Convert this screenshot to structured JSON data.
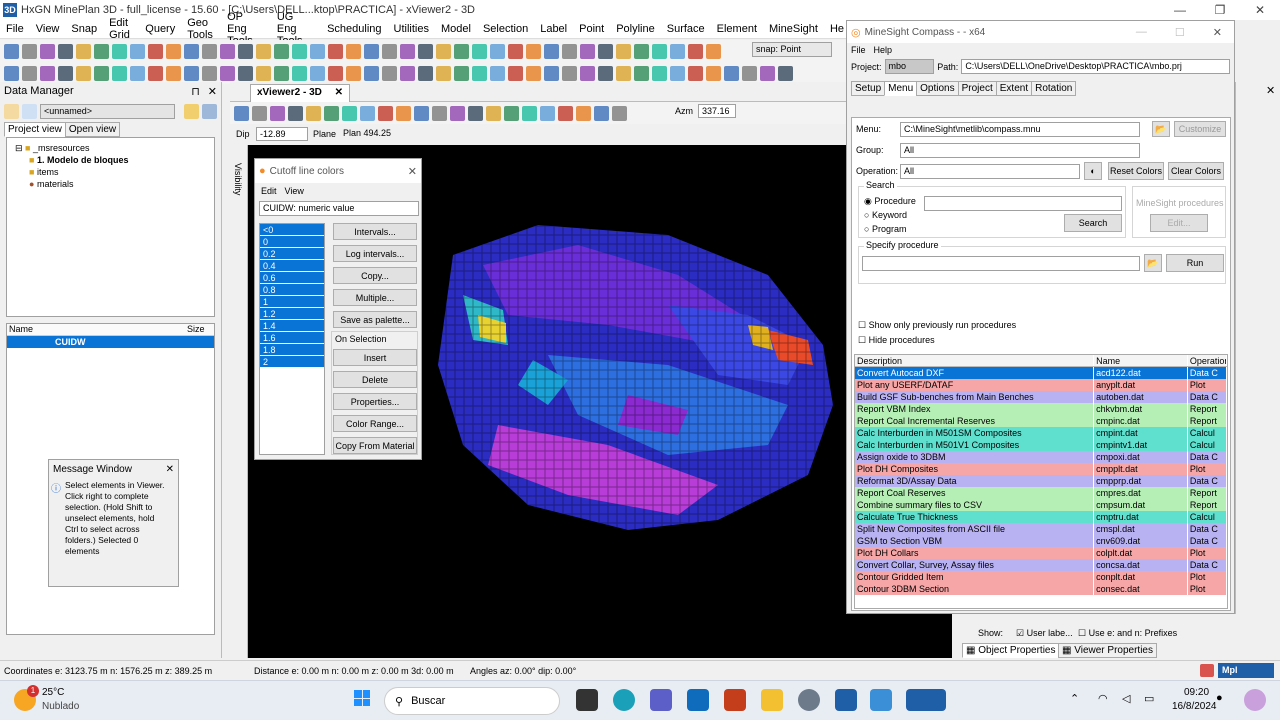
{
  "app": {
    "title": "HxGN MinePlan 3D - full_license - 15.60 - [C:\\Users\\DELL...ktop\\PRACTICA] - xViewer2 - 3D",
    "icon": "3D"
  },
  "menu": [
    "File",
    "View",
    "Snap",
    "Edit Grid",
    "Query",
    "Geo Tools",
    "OP Eng Tools",
    "UG Eng Tools",
    "Scheduling",
    "Utilities",
    "Model",
    "Selection",
    "Label",
    "Point",
    "Polyline",
    "Surface",
    "Element",
    "MineSight",
    "He"
  ],
  "toolbar": {
    "snap_label": "snap: Point"
  },
  "data_manager": {
    "title": "Data Manager",
    "unnamed": "<unnamed>",
    "tab_project": "Project view",
    "tab_open": "Open view",
    "tree": [
      "_msresources",
      "1. Modelo de bloques",
      "items",
      "materials"
    ],
    "list_header_name": "Name",
    "list_header_size": "Size",
    "list_item": "CUIDW"
  },
  "message_window": {
    "title": "Message Window",
    "text": "Select elements in Viewer. Click right to complete selection. (Hold Shift to unselect elements, hold Ctrl to select across folders.) Selected 0 elements"
  },
  "viewer": {
    "tab": "xViewer2 - 3D",
    "azm_label": "Azm",
    "azm": "337.16",
    "dip_label": "Dip",
    "dip": "-12.89",
    "plane_label": "Plane",
    "plane": "Plan 494.25",
    "visibility": "Visibility"
  },
  "cutoff": {
    "title": "Cutoff line colors",
    "menu": [
      "Edit",
      "View"
    ],
    "field": "CUIDW: numeric value",
    "values": [
      "<0",
      "0",
      "0.2",
      "0.4",
      "0.6",
      "0.8",
      "1",
      "1.2",
      "1.4",
      "1.6",
      "1.8",
      "2"
    ],
    "buttons": [
      "Intervals...",
      "Log intervals...",
      "Copy...",
      "Multiple...",
      "Save as palette..."
    ],
    "on_selection": "On Selection",
    "sel_buttons": [
      "Insert",
      "Delete",
      "Properties...",
      "Color Range...",
      "Copy From Material"
    ]
  },
  "compass": {
    "title": "MineSight Compass -  - x64",
    "menu": [
      "File",
      "Help"
    ],
    "project_label": "Project:",
    "project": "mbo",
    "path_label": "Path:",
    "path": "C:\\Users\\DELL\\OneDrive\\Desktop\\PRACTICA\\mbo.prj",
    "tabs": [
      "Setup",
      "Menu",
      "Options",
      "Project",
      "Extent",
      "Rotation"
    ],
    "menu_label": "Menu:",
    "menu_value": "C:\\MineSight\\metlib\\compass.mnu",
    "customize": "Customize",
    "group_label": "Group:",
    "group_value": "All",
    "operation_label": "Operation:",
    "operation_value": "All",
    "reset_colors": "Reset Colors",
    "clear_colors": "Clear Colors",
    "search_title": "Search",
    "radio": [
      "Procedure",
      "Keyword",
      "Program"
    ],
    "search_btn": "Search",
    "ms_proc": "MineSight procedures",
    "edit": "Edit...",
    "specify": "Specify procedure",
    "run": "Run",
    "chk1": "Show only previously run procedures",
    "chk2": "Hide procedures",
    "cols": [
      "Description",
      "Name",
      "Operation"
    ],
    "rows": [
      {
        "d": "Convert Autocad DXF",
        "n": "acd122.dat",
        "o": "Data C",
        "c": "sel"
      },
      {
        "d": "Plot any USERF/DATAF",
        "n": "anyplt.dat",
        "o": "Plot",
        "c": "c-red"
      },
      {
        "d": "Build GSF Sub-benches from Main Benches",
        "n": "autoben.dat",
        "o": "Data C",
        "c": "c-pur"
      },
      {
        "d": "Report VBM Index",
        "n": "chkvbm.dat",
        "o": "Report",
        "c": "c-green"
      },
      {
        "d": "Report Coal Incremental Reserves",
        "n": "cmpinc.dat",
        "o": "Report",
        "c": "c-green"
      },
      {
        "d": "Calc Interburden in M501SM Composites",
        "n": "cmpint.dat",
        "o": "Calcul",
        "c": "c-teal"
      },
      {
        "d": "Calc Interburden in M501V1 Composites",
        "n": "cmpintv1.dat",
        "o": "Calcul",
        "c": "c-teal"
      },
      {
        "d": "Assign oxide to 3DBM",
        "n": "cmpoxi.dat",
        "o": "Data C",
        "c": "c-pur"
      },
      {
        "d": "Plot DH Composites",
        "n": "cmpplt.dat",
        "o": "Plot",
        "c": "c-red"
      },
      {
        "d": "Reformat 3D/Assay Data",
        "n": "cmpprp.dat",
        "o": "Data C",
        "c": "c-pur"
      },
      {
        "d": "Report Coal Reserves",
        "n": "cmpres.dat",
        "o": "Report",
        "c": "c-green"
      },
      {
        "d": "Combine summary files to CSV",
        "n": "cmpsum.dat",
        "o": "Report",
        "c": "c-green"
      },
      {
        "d": "Calculate True Thickness",
        "n": "cmptru.dat",
        "o": "Calcul",
        "c": "c-teal"
      },
      {
        "d": "Split New Composites from ASCII file",
        "n": "cmspl.dat",
        "o": "Data C",
        "c": "c-pur"
      },
      {
        "d": "GSM to Section VBM",
        "n": "cnv609.dat",
        "o": "Data C",
        "c": "c-pur"
      },
      {
        "d": "Plot DH Collars",
        "n": "colplt.dat",
        "o": "Plot",
        "c": "c-red"
      },
      {
        "d": "Convert Collar, Survey, Assay files",
        "n": "concsa.dat",
        "o": "Data C",
        "c": "c-pur"
      },
      {
        "d": "Contour Gridded Item",
        "n": "conplt.dat",
        "o": "Plot",
        "c": "c-red"
      },
      {
        "d": "Contour 3DBM Section",
        "n": "consec.dat",
        "o": "Plot",
        "c": "c-red"
      }
    ]
  },
  "right_bottom": {
    "show": "Show:",
    "user_label": "User labe...",
    "prefix": "Use e: and n: Prefixes",
    "obj_props": "Object Properties",
    "viewer_props": "Viewer Properties"
  },
  "status": {
    "coords": "Coordinates  e: 3123.75 m   n: 1576.25 m   z: 389.25 m",
    "distance": "Distance  e: 0.00 m   n: 0.00 m   z: 0.00 m   3d: 0.00 m",
    "angles": "Angles  az:  0.00°  dip: 0.00°",
    "mpl": "Mpl"
  },
  "taskbar": {
    "temp": "25°C",
    "weather": "Nublado",
    "search": "Buscar",
    "time": "09:20",
    "date": "16/8/2024",
    "badge": "1"
  }
}
